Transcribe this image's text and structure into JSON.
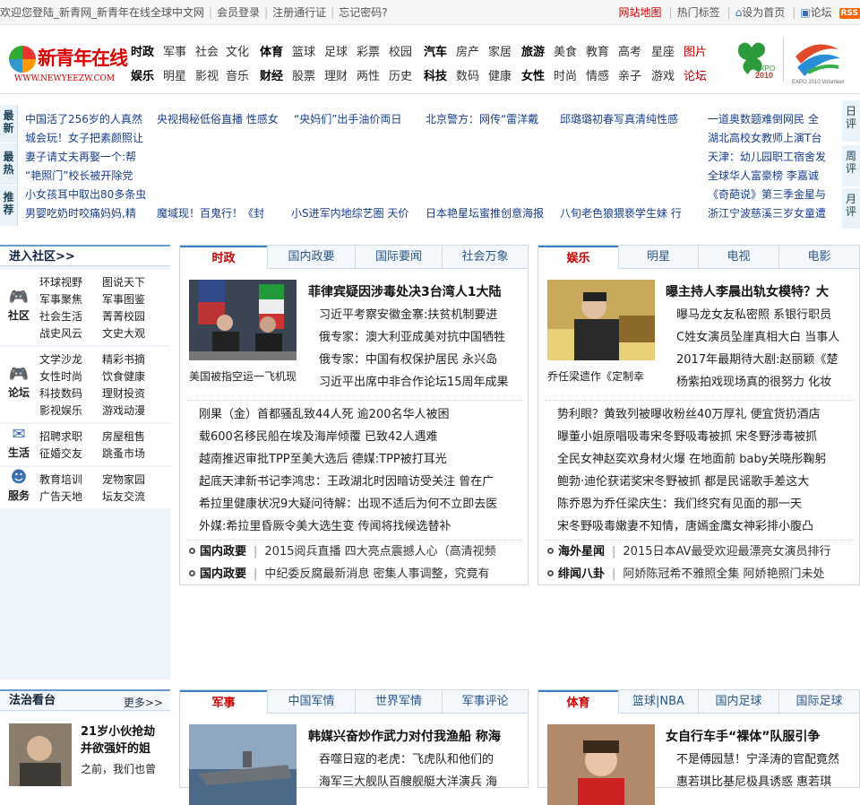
{
  "topbar": {
    "welcome": "欢迎您登陆_新青网_新青年在线全球中文网",
    "login": "会员登录",
    "register": "注册通行证",
    "forgot": "忘记密码?",
    "sitemap": "网站地图",
    "hot": "热门标签",
    "home": "设为首页",
    "forum": "论坛",
    "rss": "RSS"
  },
  "logo": {
    "name": "新青年在线",
    "url": "WWW.NEWYEEZW.COM"
  },
  "nav": {
    "row1": [
      "时政",
      "军事",
      "社会",
      "文化",
      "体育",
      "篮球",
      "足球",
      "彩票",
      "校园",
      "汽车",
      "房产",
      "家居",
      "旅游",
      "美食",
      "教育",
      "高考",
      "星座",
      "图片"
    ],
    "row2": [
      "娱乐",
      "明星",
      "影视",
      "音乐",
      "财经",
      "股票",
      "理财",
      "两性",
      "历史",
      "科技",
      "数码",
      "健康",
      "女性",
      "时尚",
      "情感",
      "亲子",
      "游戏",
      "论坛"
    ]
  },
  "expo": {
    "a": "EXPO 2010 SHANGHAI CHINA",
    "b": "EXPO 2010 Volunteer"
  },
  "ticker": {
    "labels": [
      "最新",
      "最热",
      "推荐"
    ],
    "rlabels": [
      "日评",
      "周评",
      "月评"
    ],
    "r1": [
      "中国活了256岁的人真然",
      "央视揭秘低俗直播 性感女",
      "“央妈们”出手油价両日",
      "北京警方：网传“雷洋戴",
      "邱璐璐初春写真清纯性感"
    ],
    "l2": [
      "城会玩！女子把素颜照让",
      "妻子请丈夫再娶一个:帮",
      "“艳照门”校长被开除党",
      "小女孩耳中取出80多条虫"
    ],
    "r5": [
      "男婴吃奶时咬痛妈妈,精",
      "魔域现！百鬼行！《封",
      "小S进军内地综艺圈 天价",
      "日本艳星坛蜜推创意海报",
      "八旬老色狼猥亵学生妹 行"
    ],
    "right": [
      "一道奥数题难倒网民 全",
      "湖北高校女教师上演T台",
      "天津：幼儿园职工宿舍发",
      "全球华人富豪榜 李嘉诚",
      "《奇葩说》第三季金星与",
      "浙江宁波慈溪三岁女童遭"
    ]
  },
  "side": {
    "title": "进入社区>>",
    "groups": [
      {
        "icon": "社区",
        "items": [
          "环球视野",
          "图说天下",
          "军事聚焦",
          "军事图鉴",
          "社会生活",
          "菁菁校园",
          "战史风云",
          "文史大观"
        ]
      },
      {
        "icon": "论坛",
        "items": [
          "文学沙龙",
          "精彩书摘",
          "女性时尚",
          "饮食健康",
          "科技数码",
          "理财投资",
          "影视娱乐",
          "游戏动漫"
        ]
      },
      {
        "icon": "生活",
        "items": [
          "招聘求职",
          "房屋租售",
          "征婚交友",
          "跳蚤市场"
        ]
      },
      {
        "icon": "服务",
        "items": [
          "教育培训",
          "宠物家园",
          "广告天地",
          "坛友交流"
        ]
      }
    ]
  },
  "box1": {
    "tabs": [
      "时政",
      "国内政要",
      "国际要闻",
      "社会万象"
    ],
    "caption": "美国被指空运一飞机现",
    "headline": "菲律宾疑因涉毒处决3台湾人1大陆",
    "bullets": [
      "习近平考察安徽金寨:扶贫机制要进",
      "俄专家：澳大利亚成美对抗中国牺牲",
      "俄专家：中国有权保护居民 永兴岛",
      "习近平出席中非合作论坛15周年成果"
    ],
    "list": [
      "刚果（金）首都骚乱致44人死 逾200名华人被困",
      "载600名移民船在埃及海岸倾覆 已致42人遇难",
      "越南推迟审批TPP至美大选后 德媒:TPP被打耳光",
      "起底天津新书记李鸿忠：王政湖北时因暗访受关注 曾在广",
      "希拉里健康状况9大疑问待解：出现不适后为何不立即去医",
      "外媒:希拉里昏厥令美大选生变 传闻将找候选替补"
    ],
    "cats": [
      {
        "name": "国内政要",
        "text": "2015阅兵直播 四大亮点震撼人心（高清视频"
      },
      {
        "name": "国内政要",
        "text": "中纪委反腐最新消息 密集人事调整，究竟有"
      }
    ]
  },
  "box2": {
    "tabs": [
      "娱乐",
      "明星",
      "电视",
      "电影"
    ],
    "caption": "乔任梁遗作《定制幸",
    "headline": "曝主持人李晨出轨女模特？大",
    "bullets": [
      "曝马龙女友私密照 系银行职员",
      "C姓女演员坠崖真相大白 当事人",
      "2017年最期待大剧:赵丽颖《楚",
      "杨紫拍戏现场真的很努力 化妆"
    ],
    "list": [
      "势利眼？黄致列被曝收粉丝40万厚礼 便宜货扔酒店",
      "曝董小姐原唱吸毒宋冬野吸毒被抓 宋冬野涉毒被抓",
      "全民女神赵奕欢身材火爆 在地面前 baby关晓彤鞠躬",
      "鲍勃·迪伦获诺奖宋冬野被抓 都是民谣歌手差这大",
      "陈乔恩为乔任梁庆生：我们终究有见面的那一天",
      "宋冬野吸毒嫩妻不知情，唐嫣金鹰女神彩排小腹凸"
    ],
    "cats": [
      {
        "name": "海外星闻",
        "text": "2015日本AV最受欢迎最漂亮女演员排行"
      },
      {
        "name": "绯闻八卦",
        "text": "阿娇陈冠希不雅照全集 阿娇艳照门未处"
      }
    ]
  },
  "fz": {
    "title": "法治看台",
    "more": "更多>>",
    "headline": "21岁小伙抢劫并欲强奸的姐",
    "text": "之前，我们也曾"
  },
  "box3": {
    "tabs": [
      "军事",
      "中国军情",
      "世界军情",
      "军事评论"
    ],
    "headline": "韩媒兴奋炒作武力对付我渔船 称海",
    "bullets": [
      "吞噬日寇的老虎：飞虎队和他们的",
      "海军三大舰队百艘舰艇大洋演兵 海"
    ]
  },
  "box4": {
    "tabs": [
      "体育",
      "篮球|NBA",
      "国内足球",
      "国际足球"
    ],
    "headline": "女自行车手“裸体”队服引争",
    "bullets": [
      "不是傅园慧！宁泽涛的官配竟然",
      "惠若琪比基尼极具诱惑 惠若琪"
    ]
  }
}
